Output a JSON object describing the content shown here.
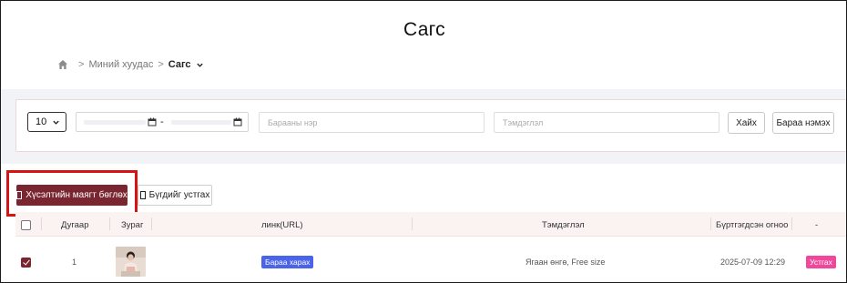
{
  "page": {
    "title": "Сагс"
  },
  "breadcrumb": {
    "home_icon": "home-icon",
    "separator": ">",
    "parent": "Миний хуудас",
    "current": "Сагс"
  },
  "filters": {
    "page_size": "10",
    "date_separator": "-",
    "product_name_placeholder": "Барааны нэр",
    "note_placeholder": "Тэмдэглэл",
    "search_label": "Хайх",
    "add_product_label": "Бараа нэмэх"
  },
  "actions": {
    "request_label": "Хүсэлтийн маягт бөглөх",
    "delete_all_label": "Бүгдийг устгах"
  },
  "table": {
    "headers": [
      "Дугаар",
      "Зураг",
      "линк(URL)",
      "Тэмдэглэл",
      "Бүртгэгдсэн огноо",
      "-"
    ],
    "rows": [
      {
        "checked": true,
        "number": "1",
        "link_label": "Бараа харах",
        "note": "Ягаан өнгө, Free size",
        "date": "2025-07-09 12:29",
        "delete_label": "Устгах"
      }
    ]
  },
  "colors": {
    "primary": "#7a2630",
    "highlight_border": "#d61414",
    "link_badge": "#4a63e8",
    "delete_badge": "#f0479a",
    "band": "#f1f3f6"
  }
}
